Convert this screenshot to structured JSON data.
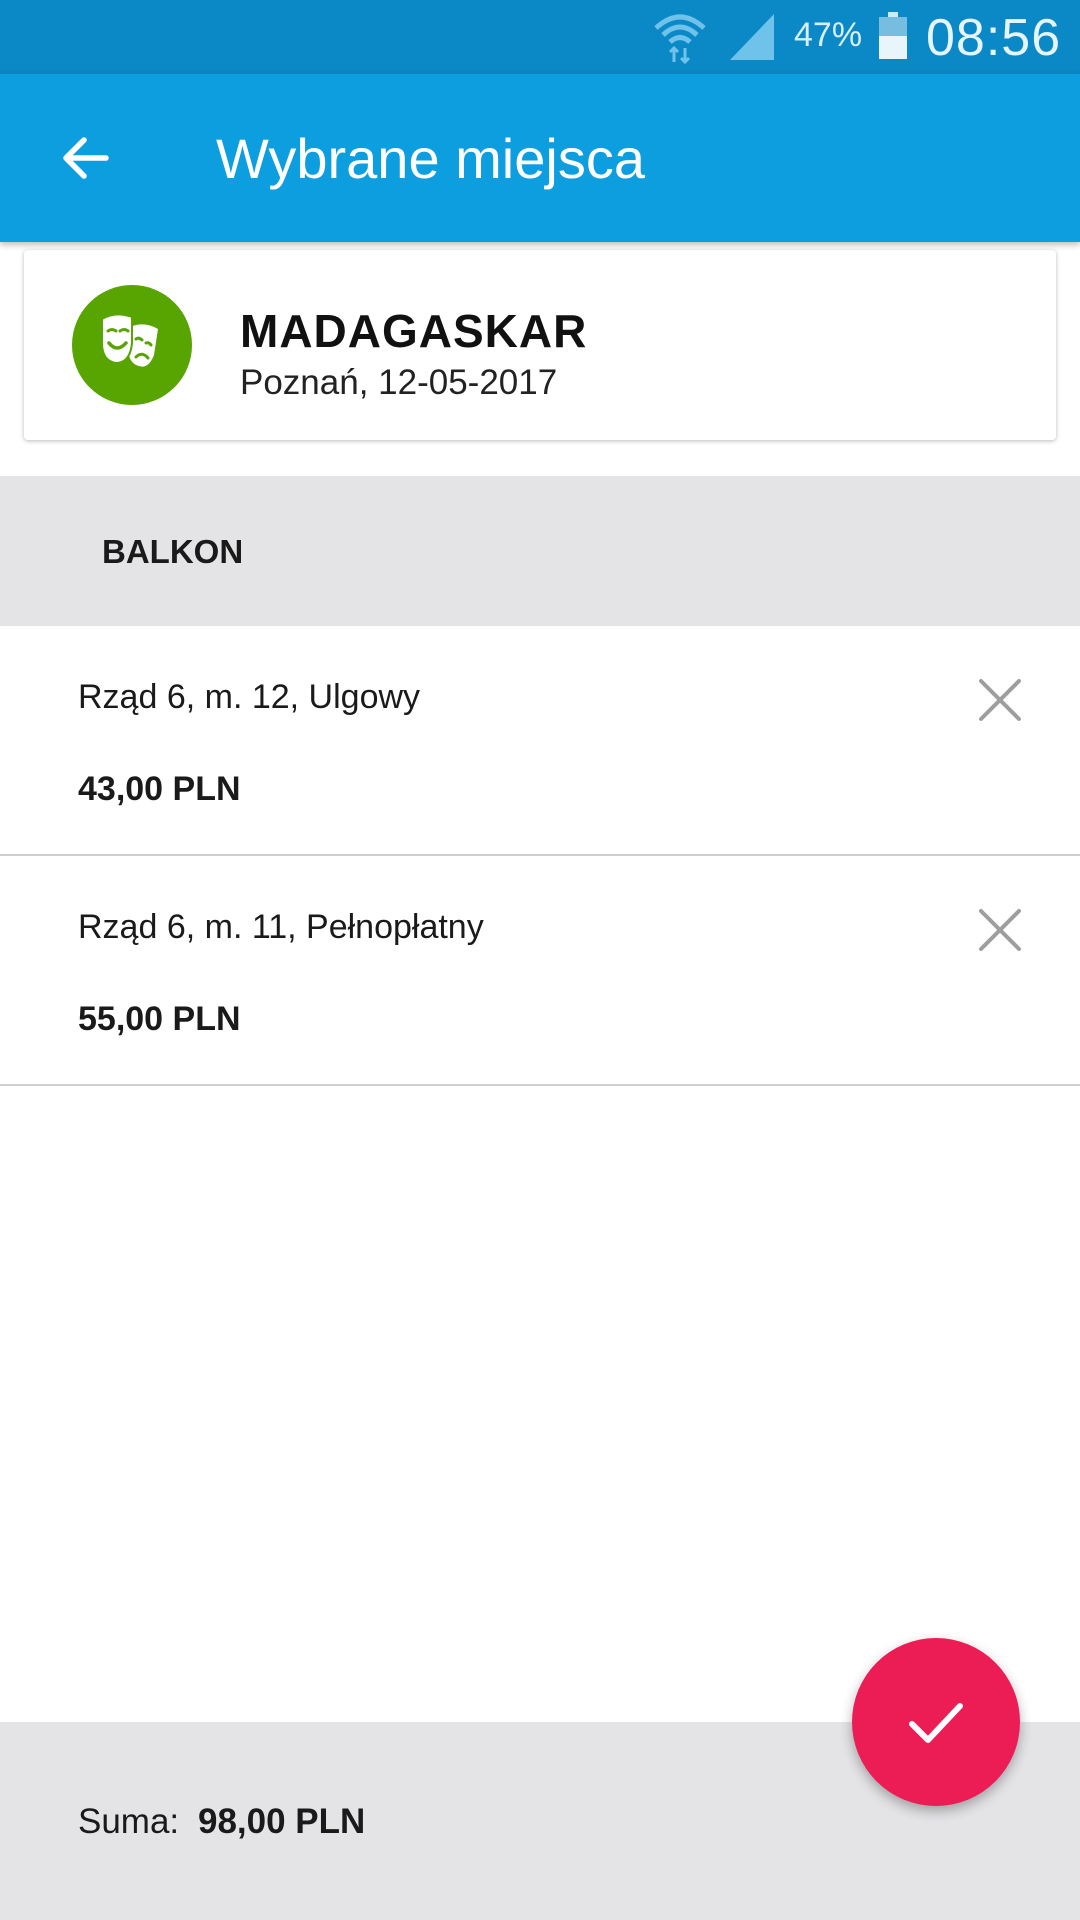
{
  "status_bar": {
    "battery_percent": "47%",
    "time": "08:56",
    "icons": [
      "wifi-icon",
      "signal-icon",
      "battery-icon"
    ]
  },
  "app_bar": {
    "back_icon": "arrow-left-icon",
    "title": "Wybrane miejsca"
  },
  "event": {
    "icon": "theater-masks-icon",
    "title": "MADAGASKAR",
    "subtitle": "Poznań, 12-05-2017"
  },
  "section": {
    "label": "BALKON"
  },
  "seats": [
    {
      "description": "Rząd 6, m. 12, Ulgowy",
      "price": "43,00 PLN",
      "remove_icon": "close-icon"
    },
    {
      "description": "Rząd 6, m. 11, Pełnopłatny",
      "price": "55,00 PLN",
      "remove_icon": "close-icon"
    }
  ],
  "footer": {
    "sum_label": "Suma:",
    "sum_value": "98,00 PLN"
  },
  "fab": {
    "icon": "check-icon"
  },
  "colors": {
    "status_bar": "#0b88c6",
    "app_bar": "#0d9edf",
    "event_icon_bg": "#58a400",
    "fab": "#ec1c55",
    "section_bg": "#e4e3e6"
  }
}
